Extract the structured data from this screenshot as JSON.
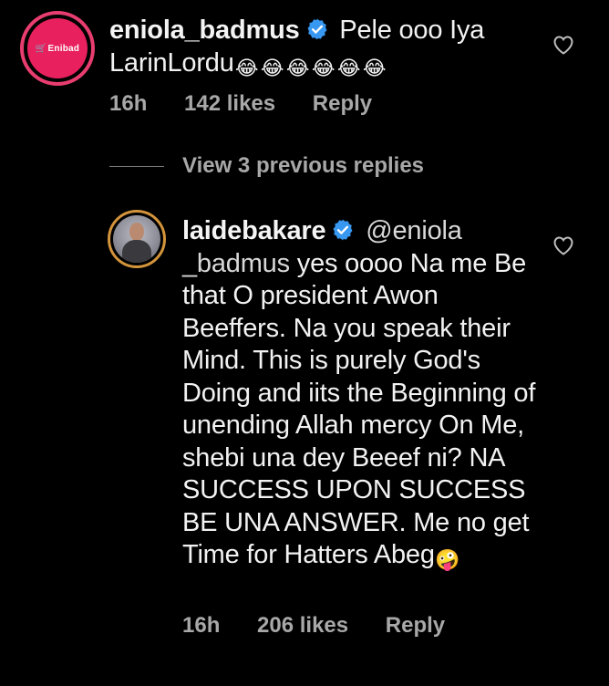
{
  "comments": [
    {
      "avatar_label": "Enibad",
      "username": "eniola_badmus",
      "text": "Pele ooo Iya LarinLordu",
      "emojis": [
        "😂",
        "😂",
        "😂",
        "😂",
        "😂",
        "😂"
      ],
      "time": "16h",
      "likes": "142 likes",
      "reply": "Reply"
    },
    {
      "username": "laidebakare",
      "mention": "@eniola _badmus",
      "text": " yes oooo Na me Be that O president Awon Beeffers.  Na you speak their Mind. This is purely God's Doing and iits the Beginning of unending Allah mercy On Me, shebi una dey Beeef ni?  NA SUCCESS UPON SUCCESS BE UNA ANSWER. Me no get Time for Hatters Abeg",
      "emoji": "🤪",
      "time": "16h",
      "likes": "206 likes",
      "reply": "Reply"
    }
  ],
  "view_replies_label": "View 3 previous replies",
  "colors": {
    "background": "#000000",
    "verified": "#3897f0",
    "brand_avatar": "#e8205e",
    "meta_text": "#a8a8a8"
  },
  "icons": {
    "verified": "verified-badge-icon",
    "like": "heart-icon"
  }
}
